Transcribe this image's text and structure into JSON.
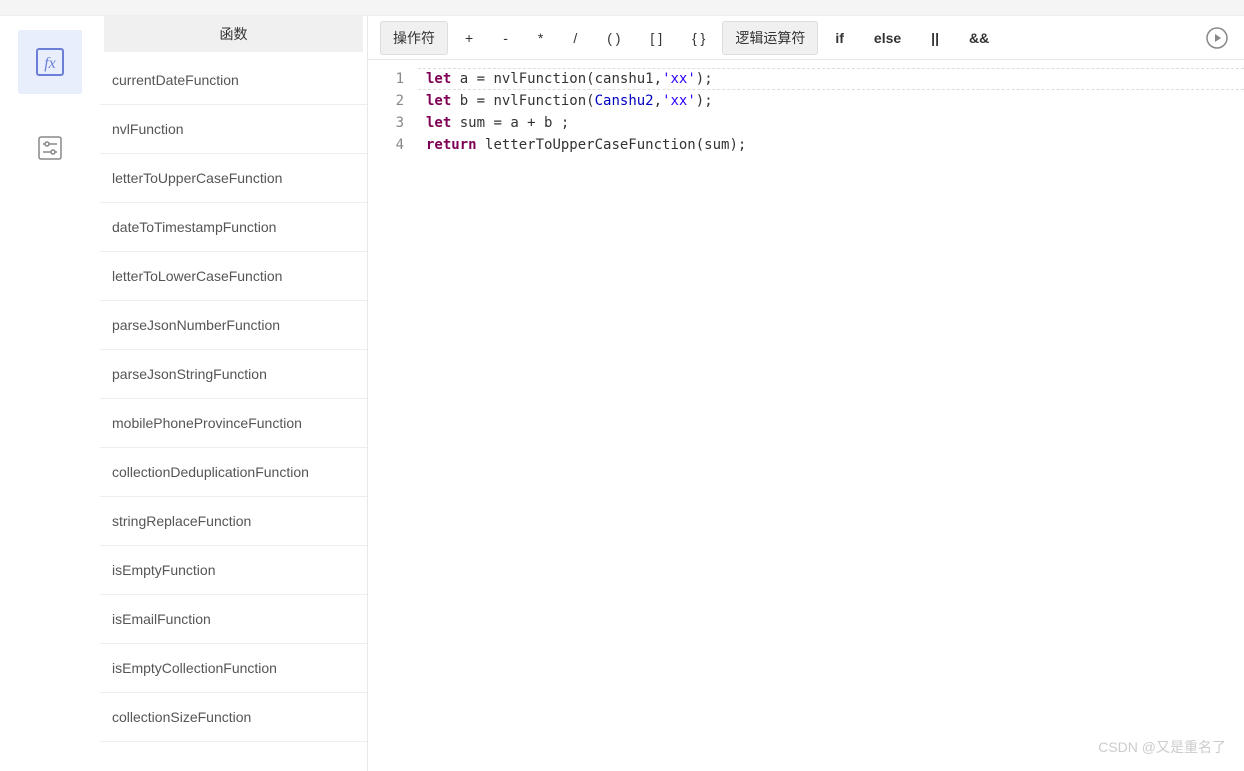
{
  "sidebar": {
    "header": "函数",
    "items": [
      "currentDateFunction",
      "nvlFunction",
      "letterToUpperCaseFunction",
      "dateToTimestampFunction",
      "letterToLowerCaseFunction",
      "parseJsonNumberFunction",
      "parseJsonStringFunction",
      "mobilePhoneProvinceFunction",
      "collectionDeduplicationFunction",
      "stringReplaceFunction",
      "isEmptyFunction",
      "isEmailFunction",
      "isEmptyCollectionFunction",
      "collectionSizeFunction"
    ]
  },
  "toolbar": {
    "operator_label": "操作符",
    "plus": "+",
    "minus": "-",
    "star": "*",
    "slash": "/",
    "paren": "( )",
    "bracket": "[ ]",
    "brace": "{ }",
    "logic_label": "逻辑运算符",
    "if": "if",
    "else": "else",
    "or": "||",
    "and": "&&"
  },
  "editor": {
    "lines": [
      {
        "num": "1",
        "tokens": [
          {
            "cls": "kw",
            "t": "let"
          },
          {
            "cls": "ident",
            "t": " a "
          },
          {
            "cls": "op",
            "t": "= "
          },
          {
            "cls": "func",
            "t": "nvlFunction"
          },
          {
            "cls": "paren",
            "t": "("
          },
          {
            "cls": "ident",
            "t": "canshu1"
          },
          {
            "cls": "op",
            "t": ","
          },
          {
            "cls": "str",
            "t": "'xx'"
          },
          {
            "cls": "paren",
            "t": ")"
          },
          {
            "cls": "op",
            "t": ";"
          }
        ]
      },
      {
        "num": "2",
        "tokens": [
          {
            "cls": "kw",
            "t": "let"
          },
          {
            "cls": "ident",
            "t": " b "
          },
          {
            "cls": "op",
            "t": "= "
          },
          {
            "cls": "func",
            "t": "nvlFunction"
          },
          {
            "cls": "paren",
            "t": "("
          },
          {
            "cls": "var-blue",
            "t": "Canshu2"
          },
          {
            "cls": "op",
            "t": ","
          },
          {
            "cls": "str",
            "t": "'xx'"
          },
          {
            "cls": "paren",
            "t": ")"
          },
          {
            "cls": "op",
            "t": ";"
          }
        ]
      },
      {
        "num": "3",
        "tokens": [
          {
            "cls": "kw",
            "t": "let"
          },
          {
            "cls": "ident",
            "t": " sum "
          },
          {
            "cls": "op",
            "t": "= "
          },
          {
            "cls": "ident",
            "t": "a "
          },
          {
            "cls": "op",
            "t": "+ "
          },
          {
            "cls": "ident",
            "t": "b "
          },
          {
            "cls": "op",
            "t": ";"
          }
        ]
      },
      {
        "num": "4",
        "tokens": [
          {
            "cls": "kw",
            "t": "return"
          },
          {
            "cls": "ident",
            "t": " "
          },
          {
            "cls": "func",
            "t": "letterToUpperCaseFunction"
          },
          {
            "cls": "paren",
            "t": "("
          },
          {
            "cls": "ident",
            "t": "sum"
          },
          {
            "cls": "paren",
            "t": ")"
          },
          {
            "cls": "op",
            "t": ";"
          }
        ]
      }
    ]
  },
  "watermark": {
    "bottom": "CSDN @又是重名了"
  }
}
